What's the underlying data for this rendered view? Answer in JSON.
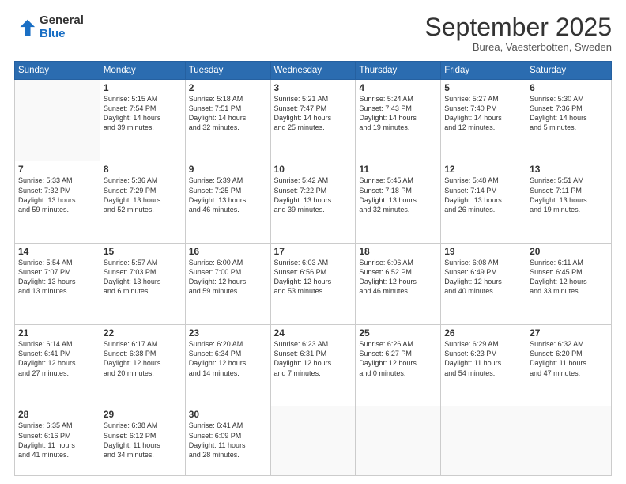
{
  "header": {
    "logo_general": "General",
    "logo_blue": "Blue",
    "month_title": "September 2025",
    "subtitle": "Burea, Vaesterbotten, Sweden"
  },
  "days_of_week": [
    "Sunday",
    "Monday",
    "Tuesday",
    "Wednesday",
    "Thursday",
    "Friday",
    "Saturday"
  ],
  "weeks": [
    [
      {
        "day": "",
        "text": ""
      },
      {
        "day": "1",
        "text": "Sunrise: 5:15 AM\nSunset: 7:54 PM\nDaylight: 14 hours\nand 39 minutes."
      },
      {
        "day": "2",
        "text": "Sunrise: 5:18 AM\nSunset: 7:51 PM\nDaylight: 14 hours\nand 32 minutes."
      },
      {
        "day": "3",
        "text": "Sunrise: 5:21 AM\nSunset: 7:47 PM\nDaylight: 14 hours\nand 25 minutes."
      },
      {
        "day": "4",
        "text": "Sunrise: 5:24 AM\nSunset: 7:43 PM\nDaylight: 14 hours\nand 19 minutes."
      },
      {
        "day": "5",
        "text": "Sunrise: 5:27 AM\nSunset: 7:40 PM\nDaylight: 14 hours\nand 12 minutes."
      },
      {
        "day": "6",
        "text": "Sunrise: 5:30 AM\nSunset: 7:36 PM\nDaylight: 14 hours\nand 5 minutes."
      }
    ],
    [
      {
        "day": "7",
        "text": "Sunrise: 5:33 AM\nSunset: 7:32 PM\nDaylight: 13 hours\nand 59 minutes."
      },
      {
        "day": "8",
        "text": "Sunrise: 5:36 AM\nSunset: 7:29 PM\nDaylight: 13 hours\nand 52 minutes."
      },
      {
        "day": "9",
        "text": "Sunrise: 5:39 AM\nSunset: 7:25 PM\nDaylight: 13 hours\nand 46 minutes."
      },
      {
        "day": "10",
        "text": "Sunrise: 5:42 AM\nSunset: 7:22 PM\nDaylight: 13 hours\nand 39 minutes."
      },
      {
        "day": "11",
        "text": "Sunrise: 5:45 AM\nSunset: 7:18 PM\nDaylight: 13 hours\nand 32 minutes."
      },
      {
        "day": "12",
        "text": "Sunrise: 5:48 AM\nSunset: 7:14 PM\nDaylight: 13 hours\nand 26 minutes."
      },
      {
        "day": "13",
        "text": "Sunrise: 5:51 AM\nSunset: 7:11 PM\nDaylight: 13 hours\nand 19 minutes."
      }
    ],
    [
      {
        "day": "14",
        "text": "Sunrise: 5:54 AM\nSunset: 7:07 PM\nDaylight: 13 hours\nand 13 minutes."
      },
      {
        "day": "15",
        "text": "Sunrise: 5:57 AM\nSunset: 7:03 PM\nDaylight: 13 hours\nand 6 minutes."
      },
      {
        "day": "16",
        "text": "Sunrise: 6:00 AM\nSunset: 7:00 PM\nDaylight: 12 hours\nand 59 minutes."
      },
      {
        "day": "17",
        "text": "Sunrise: 6:03 AM\nSunset: 6:56 PM\nDaylight: 12 hours\nand 53 minutes."
      },
      {
        "day": "18",
        "text": "Sunrise: 6:06 AM\nSunset: 6:52 PM\nDaylight: 12 hours\nand 46 minutes."
      },
      {
        "day": "19",
        "text": "Sunrise: 6:08 AM\nSunset: 6:49 PM\nDaylight: 12 hours\nand 40 minutes."
      },
      {
        "day": "20",
        "text": "Sunrise: 6:11 AM\nSunset: 6:45 PM\nDaylight: 12 hours\nand 33 minutes."
      }
    ],
    [
      {
        "day": "21",
        "text": "Sunrise: 6:14 AM\nSunset: 6:41 PM\nDaylight: 12 hours\nand 27 minutes."
      },
      {
        "day": "22",
        "text": "Sunrise: 6:17 AM\nSunset: 6:38 PM\nDaylight: 12 hours\nand 20 minutes."
      },
      {
        "day": "23",
        "text": "Sunrise: 6:20 AM\nSunset: 6:34 PM\nDaylight: 12 hours\nand 14 minutes."
      },
      {
        "day": "24",
        "text": "Sunrise: 6:23 AM\nSunset: 6:31 PM\nDaylight: 12 hours\nand 7 minutes."
      },
      {
        "day": "25",
        "text": "Sunrise: 6:26 AM\nSunset: 6:27 PM\nDaylight: 12 hours\nand 0 minutes."
      },
      {
        "day": "26",
        "text": "Sunrise: 6:29 AM\nSunset: 6:23 PM\nDaylight: 11 hours\nand 54 minutes."
      },
      {
        "day": "27",
        "text": "Sunrise: 6:32 AM\nSunset: 6:20 PM\nDaylight: 11 hours\nand 47 minutes."
      }
    ],
    [
      {
        "day": "28",
        "text": "Sunrise: 6:35 AM\nSunset: 6:16 PM\nDaylight: 11 hours\nand 41 minutes."
      },
      {
        "day": "29",
        "text": "Sunrise: 6:38 AM\nSunset: 6:12 PM\nDaylight: 11 hours\nand 34 minutes."
      },
      {
        "day": "30",
        "text": "Sunrise: 6:41 AM\nSunset: 6:09 PM\nDaylight: 11 hours\nand 28 minutes."
      },
      {
        "day": "",
        "text": ""
      },
      {
        "day": "",
        "text": ""
      },
      {
        "day": "",
        "text": ""
      },
      {
        "day": "",
        "text": ""
      }
    ]
  ]
}
